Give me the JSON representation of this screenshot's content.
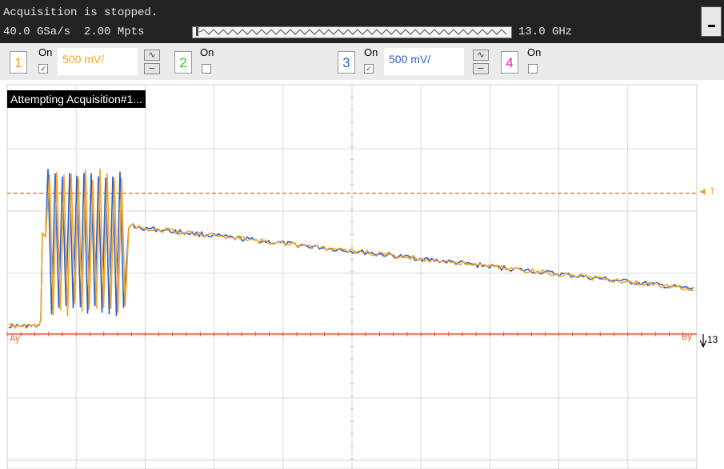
{
  "status": {
    "message": "Acquisition is stopped.",
    "sample_rate": "40.0 GSa/s",
    "memory_depth": "2.00 Mpts",
    "bandwidth": "13.0 GHz"
  },
  "channels": [
    {
      "number": "1",
      "on_label": "On",
      "checked": true,
      "scale": "500 mV/",
      "color": "#f5a623"
    },
    {
      "number": "2",
      "on_label": "On",
      "checked": false,
      "color": "#33cc33"
    },
    {
      "number": "3",
      "on_label": "On",
      "checked": true,
      "scale": "500 mV/",
      "color": "#2d5fcf"
    },
    {
      "number": "4",
      "on_label": "On",
      "checked": false,
      "color": "#e020b0"
    }
  ],
  "screen": {
    "banner": "Attempting Acquisition#1...",
    "trigger_label": "T",
    "marker_a": "Ay",
    "marker_b": "By",
    "right_marker": "13"
  },
  "colors": {
    "trace_ch1": "#f5a623",
    "trace_ch3": "#2d5fcf",
    "trigger_line": "#e8825a",
    "marker_line": "#e85a3a",
    "grid": "#d4d4d4"
  },
  "icons": {
    "coupling": "coupling-wave-icon",
    "minimize": "minimize-icon",
    "trigger": "trigger-arrow-icon"
  }
}
